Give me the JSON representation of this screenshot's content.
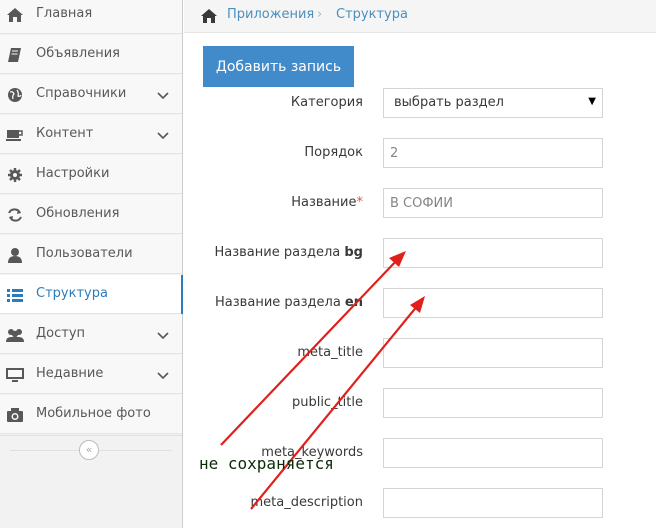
{
  "sidebar": {
    "items": [
      {
        "label": "Главная",
        "icon": "home-icon",
        "has_chevron": false
      },
      {
        "label": "Объявления",
        "icon": "book-icon",
        "has_chevron": false
      },
      {
        "label": "Справочники",
        "icon": "globe-icon",
        "has_chevron": true
      },
      {
        "label": "Контент",
        "icon": "coffee-icon",
        "has_chevron": true
      },
      {
        "label": "Настройки",
        "icon": "gear-icon",
        "has_chevron": false
      },
      {
        "label": "Обновления",
        "icon": "refresh-icon",
        "has_chevron": false
      },
      {
        "label": "Пользователи",
        "icon": "user-icon",
        "has_chevron": false
      },
      {
        "label": "Структура",
        "icon": "list-icon",
        "has_chevron": false,
        "active": true
      },
      {
        "label": "Доступ",
        "icon": "users-icon",
        "has_chevron": true
      },
      {
        "label": "Недавние",
        "icon": "desktop-icon",
        "has_chevron": true
      },
      {
        "label": "Мобильное фото",
        "icon": "camera-icon",
        "has_chevron": false
      }
    ],
    "collapse_glyph": "«"
  },
  "breadcrumb": {
    "items": [
      "Приложения",
      "Структура"
    ],
    "separator": "›"
  },
  "toolbar": {
    "add_label": "Добавить запись"
  },
  "form": {
    "category": {
      "label": "Категория",
      "value": "выбрать раздел",
      "caret": "▼"
    },
    "order": {
      "label": "Порядок",
      "value": "2"
    },
    "name": {
      "label": "Название",
      "required_mark": "*",
      "value": "В СОФИИ"
    },
    "name_bg": {
      "label": "Название раздела ",
      "lang": "bg",
      "value": ""
    },
    "name_en": {
      "label": "Название раздела ",
      "lang": "en",
      "value": ""
    },
    "meta_title": {
      "label": "meta_title",
      "value": ""
    },
    "public_title": {
      "label": "public_title",
      "value": ""
    },
    "meta_keywords": {
      "label": "meta_keywords",
      "value": ""
    },
    "meta_description": {
      "label": "meta_description",
      "value": ""
    }
  },
  "annotation": {
    "text": "не сохраняется",
    "arrow_color": "#e0201b"
  },
  "colors": {
    "accent": "#428bca",
    "active_nav": "#2b7dbc",
    "link": "#4c8fbd",
    "required": "#d15b47"
  }
}
